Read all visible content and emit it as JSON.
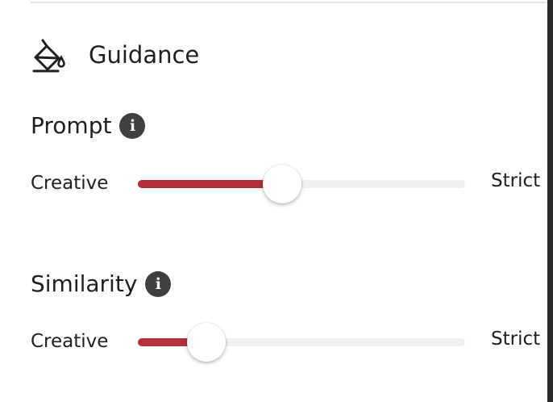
{
  "section": {
    "title": "Guidance",
    "icon": "paint-bucket-icon"
  },
  "sliders": [
    {
      "label": "Prompt",
      "info_icon": "info-icon",
      "min_label": "Creative",
      "max_label": "Strict",
      "value_fraction": 0.44
    },
    {
      "label": "Similarity",
      "info_icon": "info-icon",
      "min_label": "Creative",
      "max_label": "Strict",
      "value_fraction": 0.21
    }
  ],
  "colors": {
    "accent": "#b3303a",
    "track": "#f0f0f0",
    "info_icon_bg": "#3f3f3f",
    "text": "#1f1f1f"
  }
}
